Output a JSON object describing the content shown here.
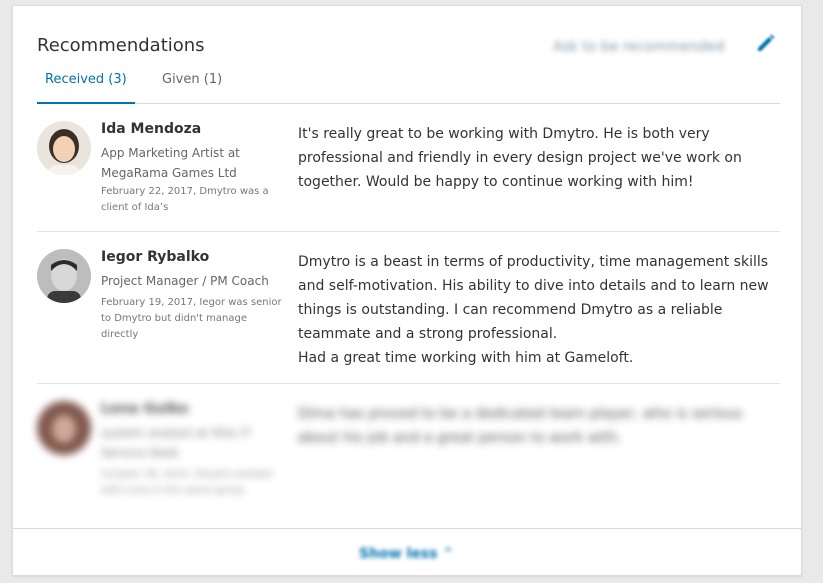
{
  "header": {
    "title": "Recommendations",
    "ask_label": "Ask to be recommended",
    "edit_icon": "pencil-icon"
  },
  "tabs": [
    {
      "label": "Received (3)",
      "active": true
    },
    {
      "label": "Given (1)",
      "active": false
    }
  ],
  "recommendations": [
    {
      "name": "Ida Mendoza",
      "role": "App Marketing Artist at MegaRama Games Ltd",
      "meta": "February 22, 2017, Dmytro was a client of Ida’s",
      "text": "It's really great to be working with Dmytro. He is both very professional and friendly in every design project we've work on together. Would be happy to continue working with him!"
    },
    {
      "name": "Iegor Rybalko",
      "role": "Project Manager / PM Coach",
      "meta": "February 19, 2017, Iegor was senior to Dmytro but didn't manage directly",
      "text": "Dmytro is a beast in terms of productivity, time management skills and self-motivation. His ability to dive into details and to learn new things is outstanding. I can recommend Dmytro as a reliable teammate and a strong professional.\nHad a great time working with him at Gameloft."
    },
    {
      "name": "Lena Gulko",
      "role": "system analyst at ItGo IT Service Desk",
      "meta": "October 28, 2015, Dmytro worked with Lena in the same group",
      "text": "Dima has proved to be a dedicated team player, who is serious about his job and a great person to work with."
    }
  ],
  "footer": {
    "show_less_label": "Show less ⌃"
  },
  "colors": {
    "accent": "#0073b1",
    "text": "#333333",
    "muted": "#666666",
    "divider": "#e3e3e3"
  }
}
